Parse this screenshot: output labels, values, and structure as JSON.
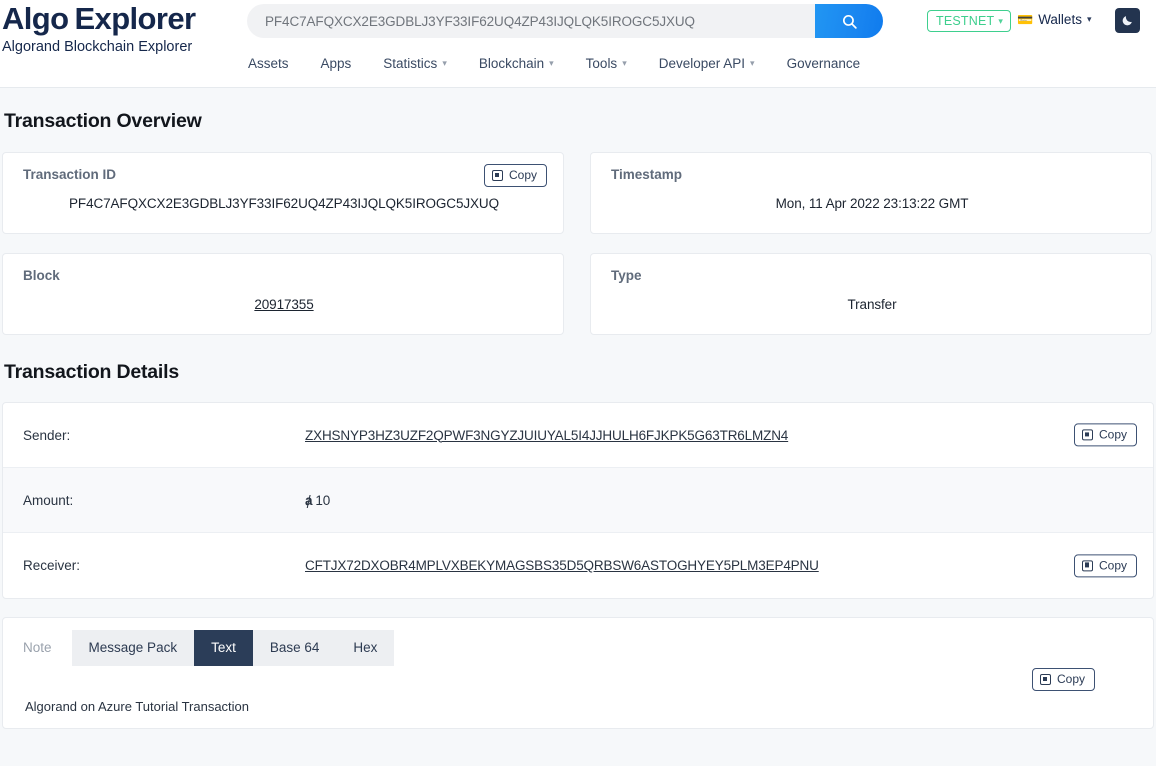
{
  "header": {
    "logo_primary": "Algo",
    "logo_secondary": "Explorer",
    "tagline": "Algorand Blockchain Explorer",
    "search": {
      "value": "PF4C7AFQXCX2E3GDBLJ3YF33IF62UQ4ZP43IJQLQK5IROGC5JXUQ",
      "placeholder": "Search",
      "button_icon": "search-icon"
    },
    "network": {
      "label": "TESTNET",
      "color": "#3ecf8e"
    },
    "wallets": {
      "label": "Wallets",
      "icon": "wallet-icon"
    },
    "dark_mode": {
      "icon": "moon-icon"
    },
    "nav": [
      {
        "label": "Assets",
        "has_dropdown": false
      },
      {
        "label": "Apps",
        "has_dropdown": false
      },
      {
        "label": "Statistics",
        "has_dropdown": true
      },
      {
        "label": "Blockchain",
        "has_dropdown": true
      },
      {
        "label": "Tools",
        "has_dropdown": true
      },
      {
        "label": "Developer API",
        "has_dropdown": true
      },
      {
        "label": "Governance",
        "has_dropdown": false
      }
    ]
  },
  "overview": {
    "title": "Transaction Overview",
    "copy_label": "Copy",
    "cards": [
      {
        "label": "Transaction ID",
        "value": "PF4C7AFQXCX2E3GDBLJ3YF33IF62UQ4ZP43IJQLQK5IROGC5JXUQ",
        "has_copy": true,
        "is_link": false
      },
      {
        "label": "Timestamp",
        "value": "Mon, 11 Apr 2022 23:13:22 GMT",
        "has_copy": false,
        "is_link": false
      },
      {
        "label": "Block",
        "value": "20917355",
        "has_copy": false,
        "is_link": true
      },
      {
        "label": "Type",
        "value": "Transfer",
        "has_copy": false,
        "is_link": false
      }
    ]
  },
  "details": {
    "title": "Transaction Details",
    "copy_label": "Copy",
    "rows": [
      {
        "label": "Sender:",
        "value": "ZXHSNYP3HZ3UZF2QPWF3NGYZJUIUYAL5I4JJHULH6FJKPK5G63TR6LMZN4",
        "is_link": true,
        "has_copy": true
      },
      {
        "label": "Amount:",
        "symbol": "ⱥ",
        "value": "10",
        "is_link": false,
        "has_copy": false
      },
      {
        "label": "Receiver:",
        "value": "CFTJX72DXOBR4MPLVXBEKYMAGSBS35D5QRBSW6ASTOGHYEY5PLM3EP4PNU",
        "is_link": true,
        "has_copy": true
      }
    ]
  },
  "note": {
    "label": "Note",
    "tabs": [
      {
        "label": "Message Pack",
        "active": false
      },
      {
        "label": "Text",
        "active": true
      },
      {
        "label": "Base 64",
        "active": false
      },
      {
        "label": "Hex",
        "active": false
      }
    ],
    "copy_label": "Copy",
    "content": "Algorand on Azure Tutorial Transaction"
  }
}
